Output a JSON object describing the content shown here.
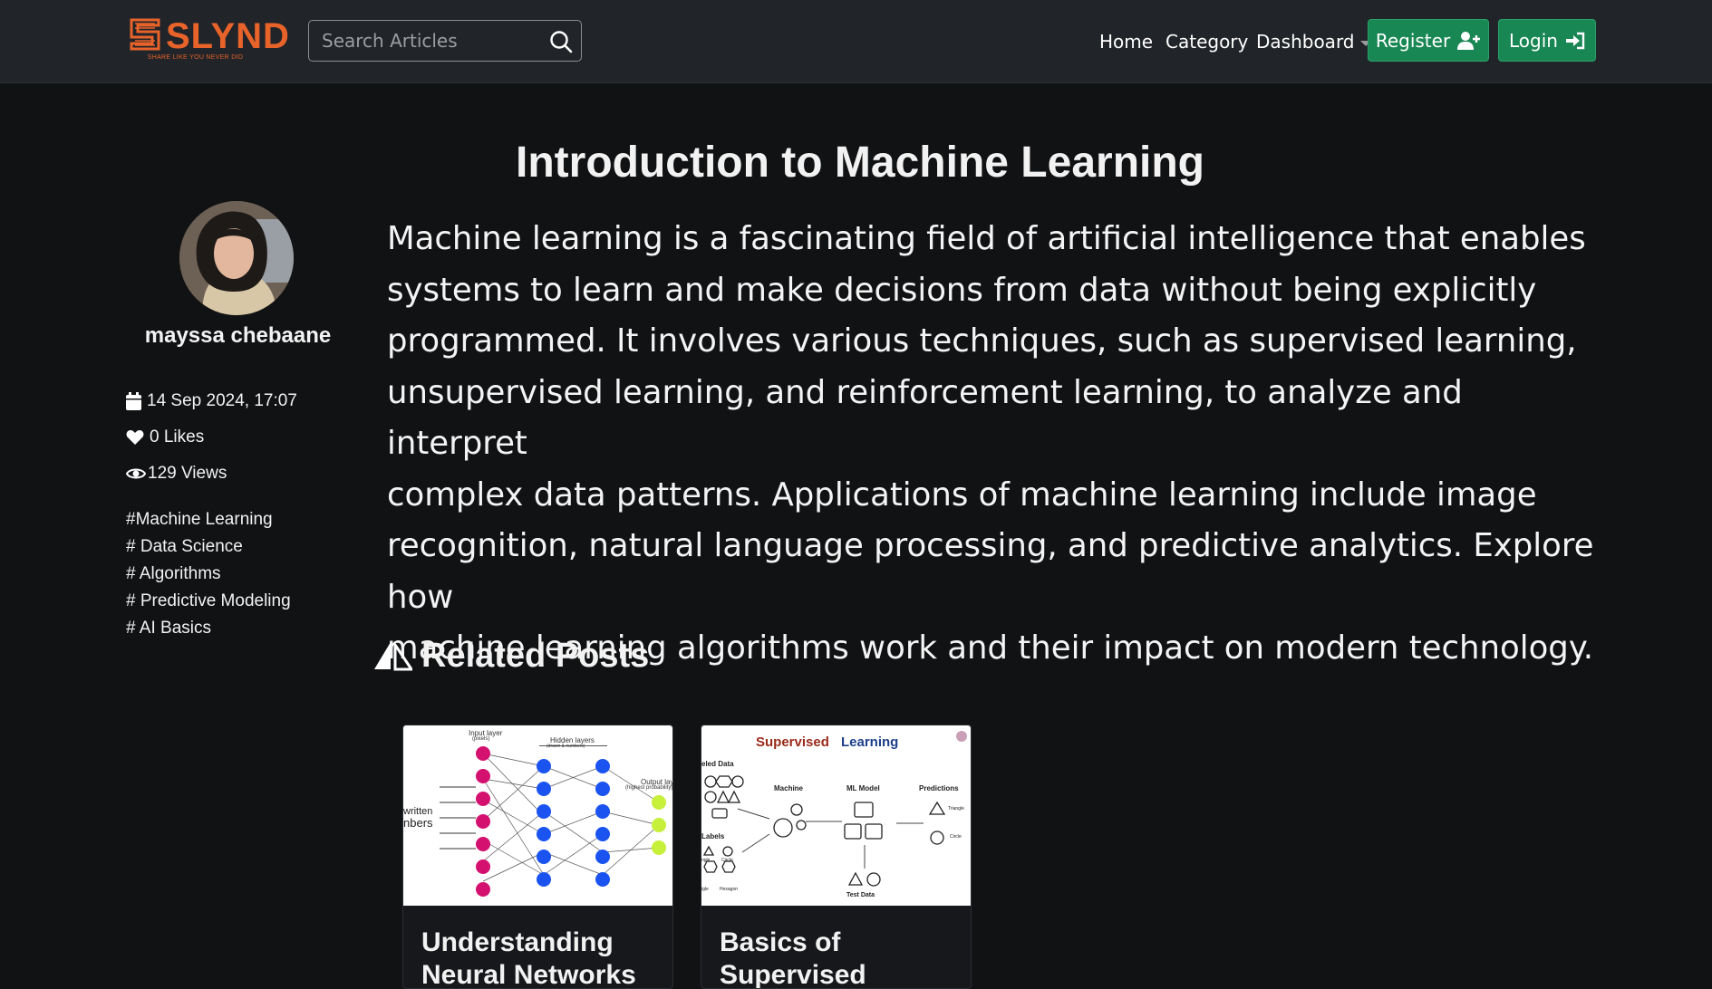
{
  "navbar": {
    "logo_text": "SLYND",
    "logo_tagline": "SHARE LIKE YOU NEVER DID",
    "search_placeholder": "Search Articles",
    "links": [
      "Home",
      "Category",
      "Dashboard"
    ],
    "register_label": "Register",
    "login_label": "Login"
  },
  "author": {
    "name": "mayssa chebaane",
    "date": "14 Sep 2024, 17:07",
    "likes": "0 Likes",
    "views": "129 Views",
    "tags": [
      "#Machine Learning",
      "# Data Science",
      "# Algorithms",
      "# Predictive Modeling",
      "# AI Basics"
    ]
  },
  "article": {
    "title": "Introduction to Machine Learning",
    "lines": [
      "Machine learning is a fascinating field of artificial intelligence that enables",
      "systems to learn and make decisions from data without being explicitly",
      "programmed. It involves various techniques, such as supervised learning,",
      "unsupervised learning, and reinforcement learning, to analyze and interpret",
      "complex data patterns. Applications of machine learning include image",
      "recognition, natural language processing, and predictive analytics. Explore how",
      "machine learning algorithms work and their impact on modern technology."
    ]
  },
  "related": {
    "heading": "Related Posts",
    "cards": [
      {
        "title_lines": [
          "Understanding",
          "Neural Networks"
        ],
        "image_labels": [
          "Input layer",
          "(pixels)",
          "Hidden layers",
          "(drawn & numbers)",
          "Output layer",
          "(highest probability)",
          "written",
          "nbers"
        ]
      },
      {
        "title_lines": [
          "Basics of",
          "Supervised"
        ],
        "image_labels": [
          "Supervised",
          "Learning",
          "eled Data",
          "Machine",
          "ML Model",
          "Predictions",
          "Labels",
          "Triangle",
          "Circle",
          "Test Data",
          "ngle",
          "Circle",
          "igle",
          "Hexagon"
        ]
      }
    ]
  },
  "colors": {
    "nav_bg": "#212429",
    "page_bg": "#111214",
    "button_green": "#198754",
    "logo_orange": "#e8632a"
  }
}
